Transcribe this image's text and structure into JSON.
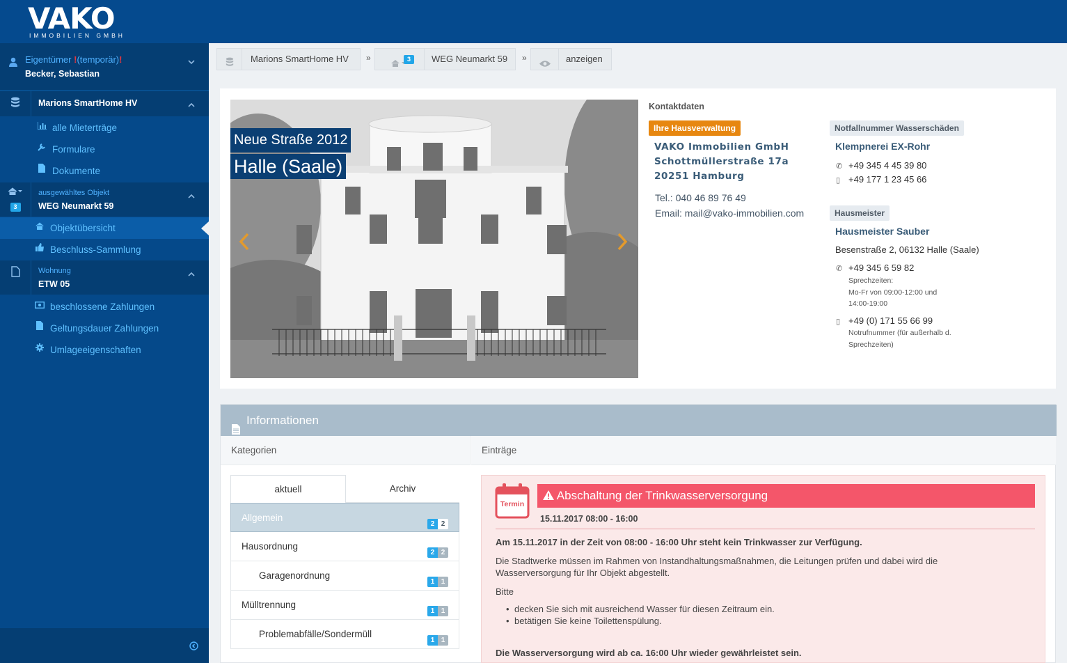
{
  "brand": {
    "name": "VAKO",
    "sub": "IMMOBILIEN GMBH"
  },
  "user": {
    "role": "Eigentümer",
    "role_tag": "(temporär)",
    "name": "Becker, Sebastian"
  },
  "sidebar": {
    "section_hv": {
      "title": "Marions SmartHome HV"
    },
    "items_hv": [
      {
        "label": "alle Mieterträge",
        "icon": "bar-chart-icon"
      },
      {
        "label": "Formulare",
        "icon": "wrench-icon"
      },
      {
        "label": "Dokumente",
        "icon": "file-icon"
      }
    ],
    "section_obj": {
      "small": "ausgewähltes Objekt",
      "title": "WEG Neumarkt 59",
      "badge": "3"
    },
    "items_obj": [
      {
        "label": "Objektübersicht",
        "icon": "home-icon"
      },
      {
        "label": "Beschluss-Sammlung",
        "icon": "thumbs-up-icon"
      }
    ],
    "section_unit": {
      "small": "Wohnung",
      "title": "ETW 05"
    },
    "items_unit": [
      {
        "label": "beschlossene Zahlungen",
        "icon": "money-icon"
      },
      {
        "label": "Geltungsdauer Zahlungen",
        "icon": "file-icon"
      },
      {
        "label": "Umlageeigenschaften",
        "icon": "gear-icon"
      }
    ]
  },
  "breadcrumb": {
    "b1": "Marions SmartHome HV",
    "b2_badge": "3",
    "b2": "WEG Neumarkt 59",
    "b3": "anzeigen",
    "sep": "»"
  },
  "slider": {
    "caption1": "Neue Straße 2012",
    "caption2": "Halle (Saale)"
  },
  "kontakt": {
    "heading": "Kontaktdaten",
    "hv_tag": "Ihre Hausverwaltung",
    "hv_name": "VAKO Immobilien GmbH",
    "hv_street": "Schottmüllerstraße 17a",
    "hv_city": "20251 Hamburg",
    "hv_tel": "Tel.: 040 46 89 76 49",
    "hv_email": "Email: mail@vako-immobilien.com",
    "notfall_tag": "Notfallnummer Wasserschäden",
    "notfall_name": "Klempnerei EX-Rohr",
    "notfall_phone": "+49 345 4 45 39 80",
    "notfall_mobile": "+49 177 1 23 45 66",
    "hm_tag": "Hausmeister",
    "hm_name": "Hausmeister Sauber",
    "hm_addr": "Besenstraße 2, 06132 Halle (Saale)",
    "hm_phone": "+49 345 6 59 82",
    "hm_note1": "Sprechzeiten:",
    "hm_note2": "Mo-Fr von 09:00-12:00 und",
    "hm_note3": "14:00-19:00",
    "hm_mobile": "+49 (0) 171 55 66 99",
    "hm_note4": "Notrufnummer (für außerhalb d.",
    "hm_note5": "Sprechzeiten)"
  },
  "info": {
    "title": "Informationen",
    "col_left": "Kategorien",
    "col_right": "Einträge",
    "tab_current": "aktuell",
    "tab_archive": "Archiv",
    "categories": [
      {
        "label": "Allgemein",
        "a": "2",
        "b": "2"
      },
      {
        "label": "Hausordnung",
        "a": "2",
        "b": "2"
      },
      {
        "label": "Garagenordnung",
        "a": "1",
        "b": "1"
      },
      {
        "label": "Mülltrennung",
        "a": "1",
        "b": "1"
      },
      {
        "label": "Problemabfälle/Sondermüll",
        "a": "1",
        "b": "1"
      }
    ]
  },
  "entry": {
    "cal_label": "Termin",
    "title": "Abschaltung der Trinkwasserversorgung",
    "date": "15.11.2017 08:00 - 16:00",
    "p1": "Am 15.11.2017 in der Zeit von 08:00 - 16:00 Uhr steht kein Trinkwasser zur Verfügung.",
    "p2a": "Die Stadtwerke müssen im Rahmen von Instandhaltungsmaßnahmen, die Leitungen prüfen und dabei wird die",
    "p2b": "Wasserversorgung für Ihr Objekt abgestellt.",
    "p3": "Bitte",
    "b1": "decken Sie sich mit ausreichend Wasser für diesen Zeitraum ein.",
    "b2": "betätigen Sie keine Toilettenspülung.",
    "p4": "Die Wasserversorgung wird ab ca. 16:00 Uhr wieder gewährleistet sein."
  }
}
